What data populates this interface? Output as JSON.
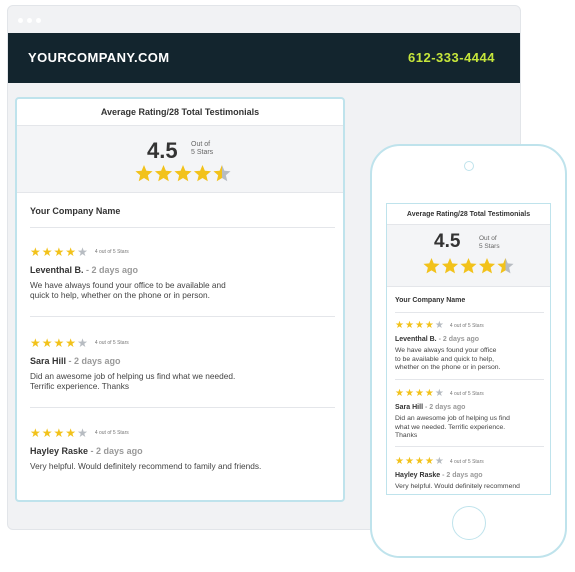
{
  "site": {
    "brand": "YOURCOMPANY.COM",
    "phone": "612-333-4444"
  },
  "widget": {
    "header": "Average Rating/28 Total Testimonials",
    "average": "4.5",
    "out_of_line1": "Out of",
    "out_of_line2": "5 Stars",
    "rating_fraction": 0.9,
    "company_name": "Your Company Name",
    "reviews": [
      {
        "stars": 4,
        "stars_label": "4 out of 5 Stars",
        "name": "Leventhal B.",
        "separator": " - ",
        "time": "2 days ago",
        "text_line1": "We have always found your office to be available and",
        "text_line2": "quick to help, whether on the phone or in person."
      },
      {
        "stars": 4,
        "stars_label": "4 out of 5 Stars",
        "name": "Sara Hill",
        "separator": " - ",
        "time": "2 days ago",
        "text_line1": "Did an awesome job of helping us find what we needed.",
        "text_line2": "Terrific experience. Thanks"
      },
      {
        "stars": 4,
        "stars_label": "4 out of 5 Stars",
        "name": "Hayley Raske",
        "separator": " - ",
        "time": "2 days ago",
        "text_line1": "Very helpful. Would definitely recommend to family and friends.",
        "text_line2": ""
      }
    ]
  },
  "phone_widget": {
    "reviews": [
      {
        "text_line1": "We have always found your office",
        "text_line2": "to be available and quick to help,",
        "text_line3": "whether on the phone or in person."
      },
      {
        "text_line1": "Did an awesome job of helping us find",
        "text_line2": "what we needed. Terrific experience.",
        "text_line3": "Thanks"
      },
      {
        "text_line1": "Very helpful. Would definitely recommend",
        "text_line2": "",
        "text_line3": ""
      }
    ]
  },
  "colors": {
    "nav_bg": "#13252e",
    "phone_accent": "#c6e63b",
    "star": "#f2c21b",
    "star_off": "#b7bcc2",
    "frame": "#bfe3ec"
  },
  "icons": {
    "star": "star-icon",
    "half_star": "half-star-icon"
  }
}
